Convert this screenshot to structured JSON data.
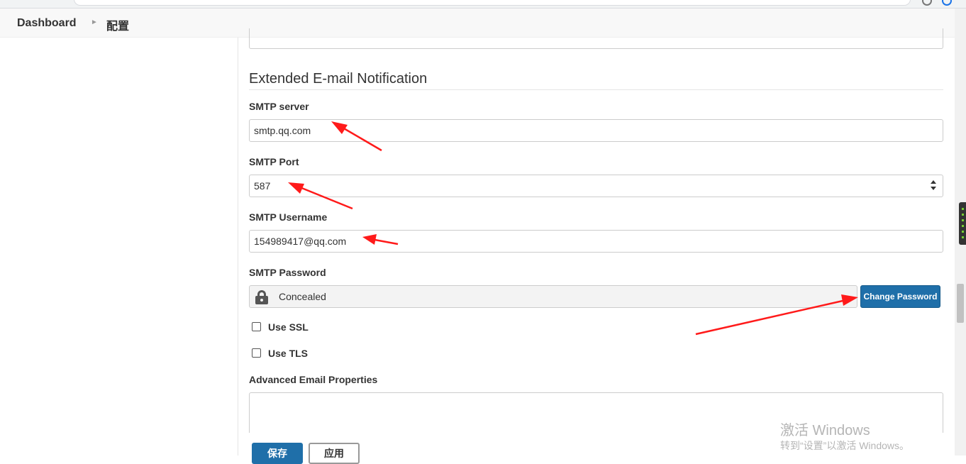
{
  "breadcrumb": {
    "dashboard": "Dashboard",
    "current": "配置"
  },
  "section": {
    "title": "Extended E-mail Notification"
  },
  "smtp_server": {
    "label": "SMTP server",
    "value": "smtp.qq.com"
  },
  "smtp_port": {
    "label": "SMTP Port",
    "value": "587"
  },
  "smtp_username": {
    "label": "SMTP Username",
    "value": "154989417@qq.com"
  },
  "smtp_password": {
    "label": "SMTP Password",
    "status": "Concealed",
    "change_button": "Change Password"
  },
  "use_ssl": {
    "label": "Use SSL",
    "checked": false
  },
  "use_tls": {
    "label": "Use TLS",
    "checked": false
  },
  "advanced": {
    "label": "Advanced Email Properties"
  },
  "actions": {
    "save": "保存",
    "apply": "应用"
  },
  "watermark": {
    "title": "激活 Windows",
    "subtitle": "转到“设置”以激活 Windows。"
  },
  "colors": {
    "primary_button": "#1f6fa9",
    "annotation_arrow": "#ff1a1a"
  }
}
